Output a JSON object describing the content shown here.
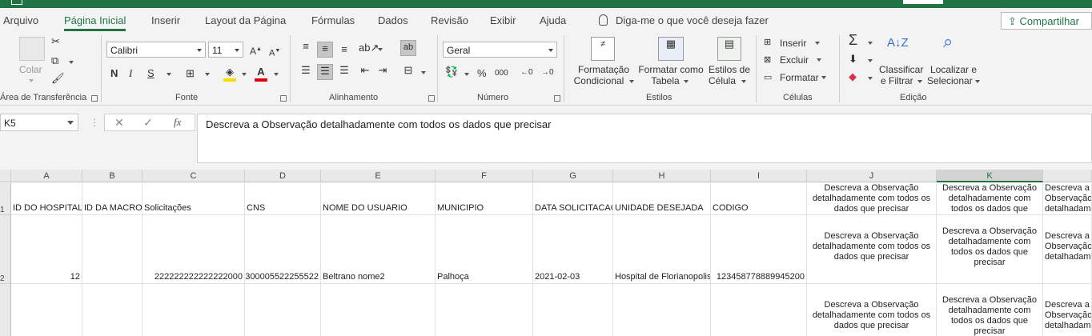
{
  "tabs": [
    "Arquivo",
    "Página Inicial",
    "Inserir",
    "Layout da Página",
    "Fórmulas",
    "Dados",
    "Revisão",
    "Exibir",
    "Ajuda"
  ],
  "tell_me": "Diga-me o que você deseja fazer",
  "share": "Compartilhar",
  "clipboard": {
    "paste": "Colar",
    "label": "Área de Transferência"
  },
  "font": {
    "name": "Calibri",
    "size": "11",
    "label": "Fonte",
    "bold": "N",
    "italic": "I",
    "underline": "S"
  },
  "alignment": {
    "label": "Alinhamento"
  },
  "number": {
    "format": "Geral",
    "label": "Número",
    "percent": "%",
    "thousands": "000"
  },
  "styles": {
    "label": "Estilos",
    "conditional_1": "Formatação",
    "conditional_2": "Condicional",
    "table_1": "Formatar como",
    "table_2": "Tabela",
    "cell_1": "Estilos de",
    "cell_2": "Célula"
  },
  "cells": {
    "label": "Células",
    "insert": "Inserir",
    "delete": "Excluir",
    "format": "Formatar"
  },
  "editing": {
    "label": "Edição",
    "sort_1": "Classificar",
    "sort_2": "e Filtrar",
    "find_1": "Localizar e",
    "find_2": "Selecionar"
  },
  "name_box": "K5",
  "formula": "Descreva a Observação detalhadamente com todos os dados que precisar",
  "columns": [
    "A",
    "B",
    "C",
    "D",
    "E",
    "F",
    "G",
    "H",
    "I",
    "J",
    "K"
  ],
  "rows": [
    {
      "num": "1",
      "A": "ID DO HOSPITAL",
      "B": "ID DA MACRO",
      "C": "Solicitações",
      "D": "CNS",
      "E": "NOME DO USUARIO",
      "F": "MUNICIPIO",
      "G": "DATA SOLICITACAO",
      "H": "UNIDADE DESEJADA",
      "I": "CODIGO",
      "J": "Descreva a Observação detalhadamente com todos os dados que precisar",
      "K": "Descreva a Observação detalhadamente com todos os dados que precisar",
      "L": "Descreva a Observação detalhadamente"
    },
    {
      "num": "2",
      "A": "12",
      "B": "",
      "C": "222222222222222000",
      "D": "300005522255522",
      "E": "Beltrano nome2",
      "F": "Palhoça",
      "G": "2021-02-03",
      "H": "Hospital de Florianopolis",
      "I": "123458778889945200",
      "J": "Descreva a Observação detalhadamente com todos os dados que precisar",
      "K": "Descreva a Observação detalhadamente com todos os dados que precisar",
      "L": "Descreva a Observação detalhadamente"
    },
    {
      "num": "3",
      "J": "Descreva a Observação detalhadamente com todos os dados que precisar",
      "K": "Descreva a Observação detalhadamente com todos os dados que precisar",
      "L": "Descreva a Observação detalhadamente"
    }
  ],
  "colors": {
    "accent": "#217346",
    "ribbon": "#f3f3f3",
    "header": "#e9e9e9"
  }
}
